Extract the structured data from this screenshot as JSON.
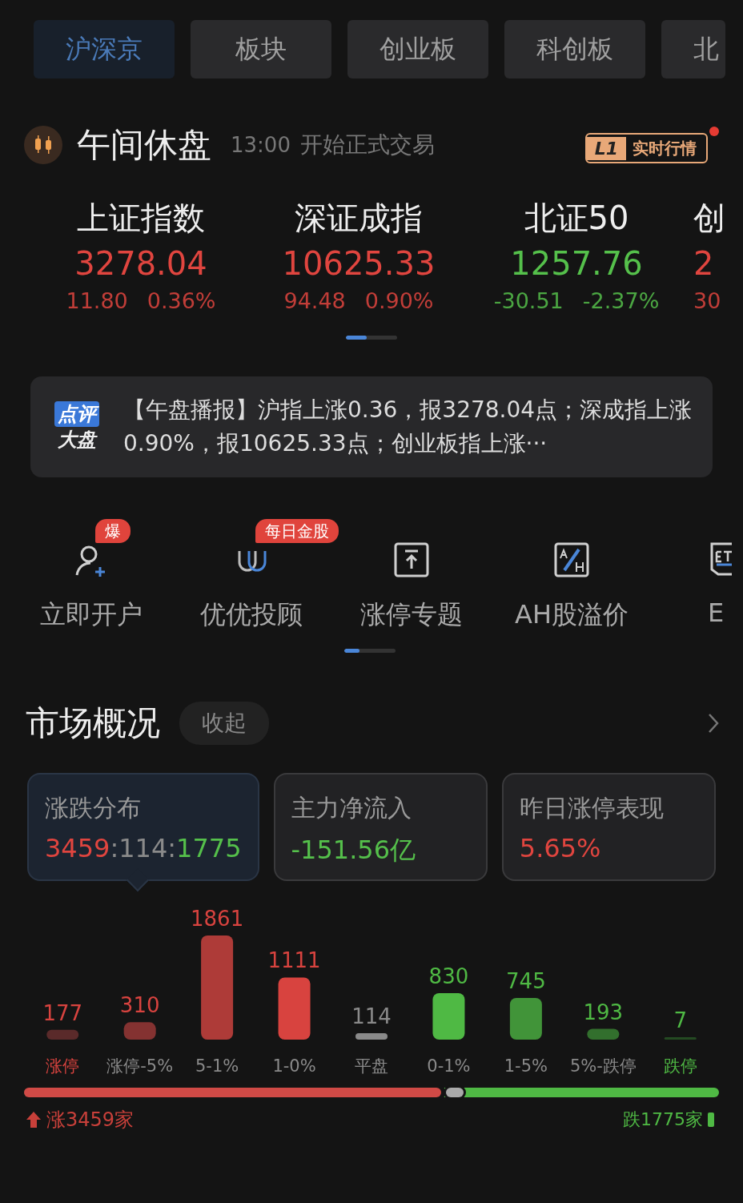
{
  "tabs": [
    {
      "label": "沪深京",
      "selected": true
    },
    {
      "label": "板块",
      "selected": false
    },
    {
      "label": "创业板",
      "selected": false
    },
    {
      "label": "科创板",
      "selected": false
    },
    {
      "label": "北",
      "selected": false
    }
  ],
  "status": {
    "title": "午间休盘",
    "time": "13:00",
    "note": "开始正式交易",
    "badge_code": "L1",
    "badge_label": "实时行情",
    "badge_dot": true
  },
  "indices": [
    {
      "name": "上证指数",
      "value": "3278.04",
      "change": "11.80",
      "percent": "0.36%",
      "color": "#e0453f"
    },
    {
      "name": "深证成指",
      "value": "10625.33",
      "change": "94.48",
      "percent": "0.90%",
      "color": "#e0453f"
    },
    {
      "name": "北证50",
      "value": "1257.76",
      "change": "-30.51",
      "percent": "-2.37%",
      "color": "#55c04b"
    },
    {
      "name": "创",
      "value": "2",
      "change": "30",
      "color": "#e0453f"
    }
  ],
  "indices_pager": {
    "level": 0.4
  },
  "news": {
    "logo_top": "点评",
    "logo_bottom": "大盘",
    "text": "【午盘播报】沪指上涨0.36，报3278.04点；深成指上涨0.90%，报10625.33点；创业板指上涨···"
  },
  "shortcuts": [
    {
      "kind": "person",
      "label": "立即开户",
      "badge": "爆"
    },
    {
      "kind": "magnet",
      "label": "优优投顾",
      "badge": "每日金股"
    },
    {
      "kind": "upload",
      "label": "涨停专题"
    },
    {
      "kind": "ah",
      "label": "AH股溢价"
    },
    {
      "kind": "etf",
      "label": "E"
    }
  ],
  "shortcuts_pager": {
    "level": 0.3
  },
  "market": {
    "title": "市场概况",
    "collapse": "收起",
    "cards": [
      {
        "title": "涨跌分布",
        "selected": true,
        "parts": [
          {
            "text": "3459",
            "color": "#e0453f"
          },
          {
            "text": ":114:",
            "color": "#8a8a8a"
          },
          {
            "text": "1775",
            "color": "#55c04b"
          }
        ]
      },
      {
        "title": "主力净流入",
        "selected": false,
        "parts": [
          {
            "text": "-151.56亿",
            "color": "#55c04b"
          }
        ]
      },
      {
        "title": "昨日涨停表现",
        "selected": false,
        "parts": [
          {
            "text": "5.65%",
            "color": "#e0453f"
          }
        ]
      }
    ],
    "chart_data": {
      "type": "bar",
      "categories": [
        "涨停",
        "涨停-5%",
        "5-1%",
        "1-0%",
        "平盘",
        "0-1%",
        "1-5%",
        "5%-跌停",
        "跌停"
      ],
      "values": [
        177,
        310,
        1861,
        1111,
        114,
        830,
        745,
        193,
        7
      ],
      "data_labels": true
    },
    "ratio": {
      "level": 0.6,
      "up_label": "涨3459家",
      "down_label": "跌1775家"
    }
  }
}
